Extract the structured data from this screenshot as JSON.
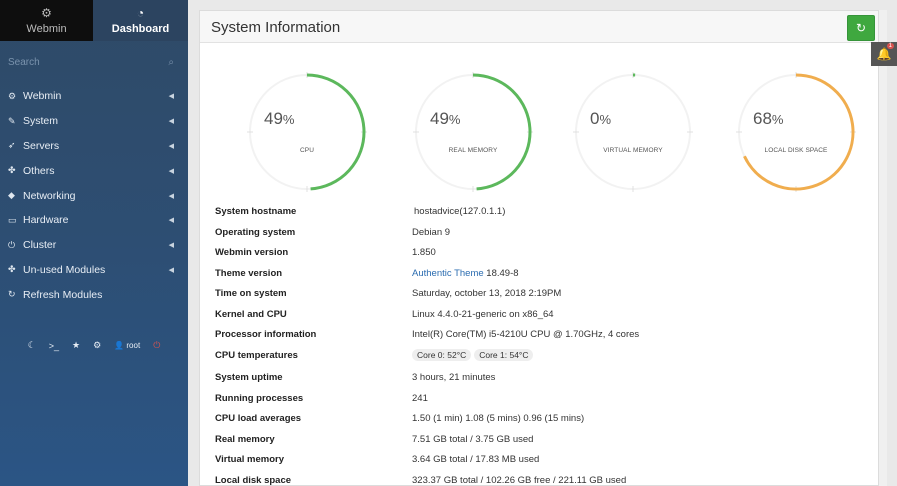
{
  "sidebar": {
    "tabs": [
      {
        "label": "Webmin",
        "icon": "webmin-logo-icon"
      },
      {
        "label": "Dashboard",
        "icon": "dashboard-icon"
      }
    ],
    "search_placeholder": "Search",
    "items": [
      {
        "label": "Webmin",
        "icon": "gear-icon"
      },
      {
        "label": "System",
        "icon": "wrench-icon"
      },
      {
        "label": "Servers",
        "icon": "rocket-icon"
      },
      {
        "label": "Others",
        "icon": "puzzle-icon"
      },
      {
        "label": "Networking",
        "icon": "shield-icon"
      },
      {
        "label": "Hardware",
        "icon": "drive-icon"
      },
      {
        "label": "Cluster",
        "icon": "power-icon"
      },
      {
        "label": "Un-used Modules",
        "icon": "puzzle-icon"
      },
      {
        "label": "Refresh Modules",
        "icon": "refresh-icon"
      }
    ],
    "bottom": {
      "user": "root"
    }
  },
  "panel": {
    "title": "System Information"
  },
  "gauges": [
    {
      "value": "49",
      "unit": "%",
      "label": "CPU",
      "percent": 49,
      "color": "#5cb85c"
    },
    {
      "value": "49",
      "unit": "%",
      "label": "REAL MEMORY",
      "percent": 49,
      "color": "#5cb85c"
    },
    {
      "value": "0",
      "unit": "%",
      "label": "VIRTUAL MEMORY",
      "percent": 0,
      "color": "#5cb85c"
    },
    {
      "value": "68",
      "unit": "%",
      "label": "LOCAL DISK SPACE",
      "percent": 68,
      "color": "#f0ad4e"
    }
  ],
  "info": {
    "hostname": {
      "key": "System hostname",
      "value": "hostadvice(127.0.1.1)"
    },
    "os": {
      "key": "Operating system",
      "value": "Debian 9"
    },
    "webmin_version": {
      "key": "Webmin version",
      "value": "1.850"
    },
    "theme_version": {
      "key": "Theme version",
      "link": "Authentic Theme",
      "value": "18.49-8"
    },
    "time": {
      "key": "Time on system",
      "value": "Saturday, october 13, 2018 2:19PM"
    },
    "kernel": {
      "key": "Kernel and CPU",
      "value": "Linux 4.4.0-21-generic on x86_64"
    },
    "processor": {
      "key": "Processor information",
      "value": "Intel(R) Core(TM) i5-4210U CPU @ 1.70GHz, 4 cores"
    },
    "cpu_temp": {
      "key": "CPU temperatures",
      "core0": "Core 0: 52°C",
      "core1": "Core 1: 54°C"
    },
    "uptime": {
      "key": "System uptime",
      "value": "3 hours, 21 minutes"
    },
    "processes": {
      "key": "Running processes",
      "value": "241"
    },
    "load": {
      "key": "CPU load averages",
      "value": "1.50 (1 min) 1.08 (5 mins) 0.96 (15 mins)"
    },
    "real_memory": {
      "key": "Real memory",
      "value": "7.51 GB total / 3.75 GB used"
    },
    "virtual_memory": {
      "key": "Virtual memory",
      "value": "3.64 GB total / 17.83 MB used"
    },
    "disk": {
      "key": "Local disk space",
      "value": "323.37 GB total / 102.26 GB free / 221.11 GB used"
    }
  },
  "notifications": {
    "count": "1"
  }
}
